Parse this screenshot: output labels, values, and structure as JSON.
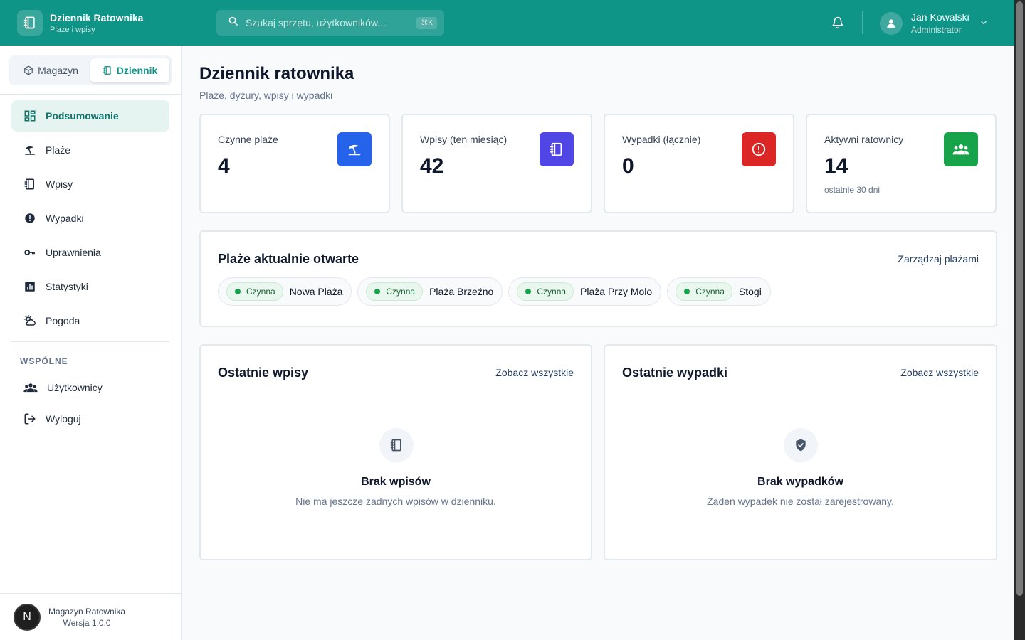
{
  "app": {
    "title": "Dziennik Ratownika",
    "subtitle": "Plaże i wpisy",
    "accent": "#0f9488"
  },
  "search": {
    "placeholder": "Szukaj sprzętu, użytkowników...",
    "shortcut": "⌘K"
  },
  "user": {
    "name": "Jan Kowalski",
    "role": "Administrator"
  },
  "switcher": {
    "items": [
      {
        "label": "Magazyn",
        "icon": "box-icon",
        "active": false
      },
      {
        "label": "Dziennik",
        "icon": "notebook-icon",
        "active": true
      }
    ]
  },
  "nav": {
    "items": [
      {
        "label": "Podsumowanie",
        "icon": "dashboard-icon",
        "active": true
      },
      {
        "label": "Plaże",
        "icon": "beach-umbrella-icon"
      },
      {
        "label": "Wpisy",
        "icon": "notebook-icon"
      },
      {
        "label": "Wypadki",
        "icon": "alert-circle-icon"
      },
      {
        "label": "Uprawnienia",
        "icon": "key-icon"
      },
      {
        "label": "Statystyki",
        "icon": "bar-chart-icon"
      },
      {
        "label": "Pogoda",
        "icon": "weather-icon"
      }
    ],
    "section_label": "WSPÓLNE",
    "shared": [
      {
        "label": "Użytkownicy",
        "icon": "users-icon"
      },
      {
        "label": "Wyloguj",
        "icon": "logout-icon"
      }
    ]
  },
  "footer": {
    "logo_letter": "N",
    "title": "Magazyn Ratownika",
    "version": "Wersja 1.0.0"
  },
  "page": {
    "title": "Dziennik ratownika",
    "subtitle": "Plaże, dyżury, wpisy i wypadki"
  },
  "stats": [
    {
      "label": "Czynne plaże",
      "value": "4",
      "note": "",
      "color": "#2563eb",
      "icon": "beach-umbrella-icon"
    },
    {
      "label": "Wpisy (ten miesiąc)",
      "value": "42",
      "note": "",
      "color": "#4f46e5",
      "icon": "notebook-icon"
    },
    {
      "label": "Wypadki (łącznie)",
      "value": "0",
      "note": "",
      "color": "#dc2626",
      "icon": "alert-circle-icon"
    },
    {
      "label": "Aktywni ratownicy",
      "value": "14",
      "note": "ostatnie 30 dni",
      "color": "#16a34a",
      "icon": "users-icon"
    }
  ],
  "beaches": {
    "title": "Plaże aktualnie otwarte",
    "link": "Zarządzaj plażami",
    "items": [
      {
        "status": "Czynna",
        "name": "Nowa Plaża"
      },
      {
        "status": "Czynna",
        "name": "Plaża Brzeźno"
      },
      {
        "status": "Czynna",
        "name": "Plaża Przy Molo"
      },
      {
        "status": "Czynna",
        "name": "Stogi"
      }
    ]
  },
  "recent_entries": {
    "title": "Ostatnie wpisy",
    "link": "Zobacz wszystkie",
    "empty_title": "Brak wpisów",
    "empty_text": "Nie ma jeszcze żadnych wpisów w dzienniku.",
    "icon": "notebook-icon"
  },
  "recent_incidents": {
    "title": "Ostatnie wypadki",
    "link": "Zobacz wszystkie",
    "empty_title": "Brak wypadków",
    "empty_text": "Żaden wypadek nie został zarejestrowany.",
    "icon": "shield-check-icon"
  }
}
